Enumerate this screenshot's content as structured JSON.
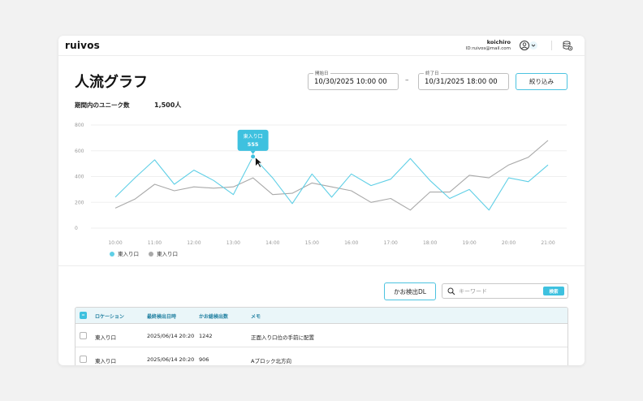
{
  "header": {
    "logo": "ruivos",
    "user_name": "koichiro",
    "user_id": "ID:ruivos@mail.com"
  },
  "page": {
    "title": "人流グラフ",
    "start": {
      "label": "開始日",
      "value": "10/30/2025 10:00 00"
    },
    "separator": "–",
    "end": {
      "label": "終了日",
      "value": "10/31/2025 18:00 00"
    },
    "filter_label": "絞り込み",
    "unique_label": "期間内のユニーク数",
    "unique_value": "1,500人"
  },
  "chart_data": {
    "type": "line",
    "x": [
      "10:00",
      "10:30",
      "11:00",
      "11:30",
      "12:00",
      "12:30",
      "13:00",
      "13:30",
      "14:00",
      "14:30",
      "15:00",
      "15:30",
      "16:00",
      "16:30",
      "17:00",
      "17:30",
      "18:00",
      "18:30",
      "19:00",
      "19:30",
      "20:00",
      "20:30",
      "21:00"
    ],
    "xticks": [
      "10:00",
      "11:00",
      "12:00",
      "13:00",
      "14:00",
      "15:00",
      "16:00",
      "17:00",
      "18:00",
      "19:00",
      "20:00",
      "21:00"
    ],
    "ylim": [
      0,
      800
    ],
    "yticks": [
      "800",
      "600",
      "400",
      "200",
      "0"
    ],
    "grid": true,
    "series": [
      {
        "name": "東入り口",
        "color": "#5fcfe6",
        "values": [
          240,
          390,
          530,
          340,
          450,
          370,
          260,
          555,
          390,
          190,
          420,
          240,
          420,
          330,
          380,
          540,
          370,
          230,
          300,
          140,
          390,
          360,
          490
        ]
      },
      {
        "name": "東入り口",
        "color": "#a9a9a9",
        "values": [
          155,
          225,
          340,
          290,
          320,
          310,
          320,
          390,
          260,
          270,
          350,
          320,
          290,
          200,
          230,
          140,
          280,
          280,
          410,
          390,
          490,
          550,
          680
        ]
      }
    ],
    "tooltip": {
      "label": "東入り口",
      "value": "555"
    },
    "legend_position": "bottom-left"
  },
  "bottom": {
    "dl_label": "かお検出DL",
    "search_placeholder": "キーワード",
    "search_button": "検索"
  },
  "table": {
    "headers": [
      "ロケーション",
      "最終検出日時",
      "かお総検出数",
      "メモ"
    ],
    "rows": [
      {
        "location": "東入り口",
        "date": "2025/06/14 20:20",
        "count": "1242",
        "memo": "正面入り口位の手前に配置"
      },
      {
        "location": "東入り口",
        "date": "2025/06/14 20:20",
        "count": "906",
        "memo": "Aブロック北方向"
      }
    ]
  }
}
